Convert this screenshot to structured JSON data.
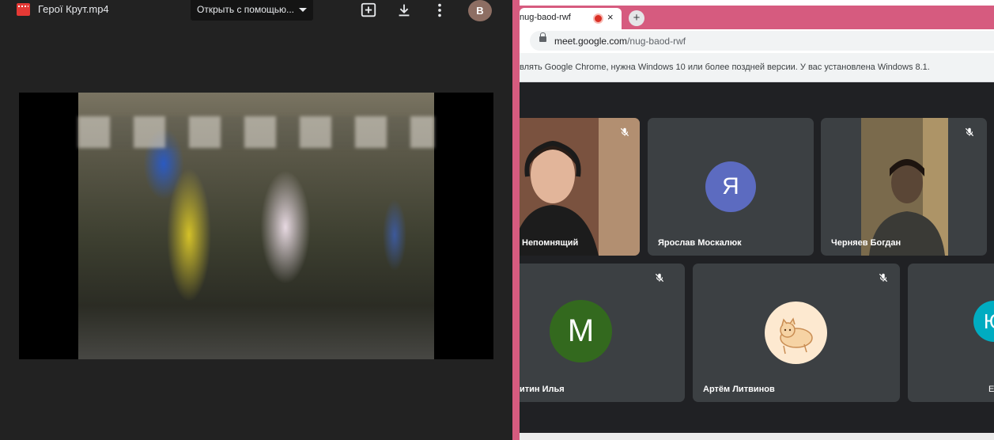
{
  "viewer": {
    "file_title": "Герої Крут.mp4",
    "open_with_label": "Открыть с помощью...",
    "account_initial": "В",
    "icons": [
      "film-icon",
      "add-to-drive-icon",
      "download-icon",
      "more-vert-icon",
      "chevron-down-icon"
    ]
  },
  "browser": {
    "tab_title": "nug-baod-rwf",
    "tab_close": "×",
    "new_tab": "+",
    "url_host": "meet.google.com",
    "url_path": "/nug-baod-rwf",
    "infobar_text": "влять Google Chrome, нужна Windows 10 или более поздней версии. У вас установлена Windows 8.1."
  },
  "meet": {
    "participants": [
      {
        "name": "Непомнящий",
        "avatar": null,
        "camera": true,
        "muted": true
      },
      {
        "name": "Ярослав Москалюк",
        "avatar": "Я",
        "avatar_color": "#5c6bc0",
        "camera": false,
        "muted": false
      },
      {
        "name": "Черняев Богдан",
        "avatar": null,
        "camera": true,
        "muted": true
      },
      {
        "name": "итин Илья",
        "avatar": "М",
        "avatar_color": "#33691e",
        "camera": false,
        "muted": true
      },
      {
        "name": "Артём Литвинов",
        "avatar": "image",
        "avatar_color": "#fde9d0",
        "camera": false,
        "muted": true
      },
      {
        "name": "Е",
        "avatar": "Ю",
        "avatar_color": "#00acc1",
        "camera": false,
        "muted": false
      }
    ]
  },
  "colors": {
    "viewer_bg": "#222222",
    "window_accent": "#d65b7f",
    "meet_bg": "#202124",
    "tile_bg": "#3c4043"
  }
}
